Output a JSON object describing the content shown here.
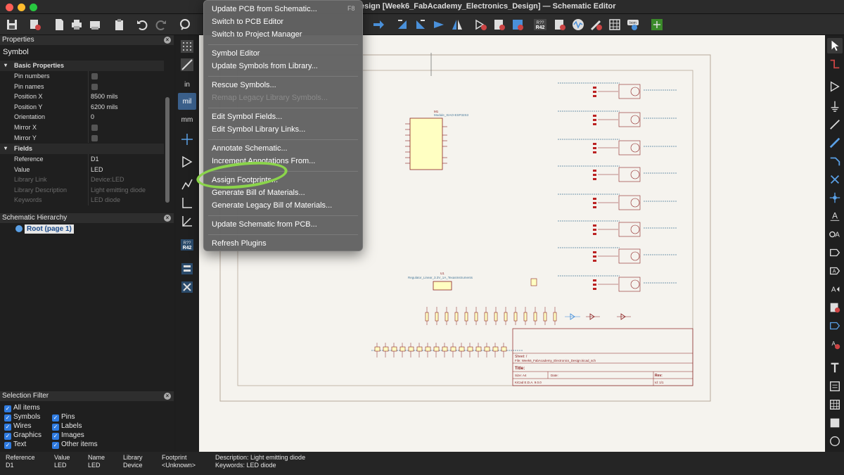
{
  "window": {
    "title": "esign [Week6_FabAcademy_Electronics_Design] — Schematic Editor"
  },
  "menu": {
    "items": [
      {
        "label": "Update PCB from Schematic...",
        "shortcut": "F8",
        "enabled": true
      },
      {
        "label": "Switch to PCB Editor",
        "enabled": true
      },
      {
        "label": "Switch to Project Manager",
        "enabled": true
      },
      {
        "label": "Symbol Editor",
        "enabled": true
      },
      {
        "label": "Update Symbols from Library...",
        "enabled": true
      },
      {
        "label": "Rescue Symbols...",
        "enabled": true
      },
      {
        "label": "Remap Legacy Library Symbols...",
        "enabled": false
      },
      {
        "label": "Edit Symbol Fields...",
        "enabled": true
      },
      {
        "label": "Edit Symbol Library Links...",
        "enabled": true
      },
      {
        "label": "Annotate Schematic...",
        "enabled": true
      },
      {
        "label": "Increment Annotations From...",
        "enabled": true
      },
      {
        "label": "Assign Footprints...",
        "enabled": true
      },
      {
        "label": "Generate Bill of Materials...",
        "enabled": true
      },
      {
        "label": "Generate Legacy Bill of Materials...",
        "enabled": true
      },
      {
        "label": "Update Schematic from PCB...",
        "enabled": true
      },
      {
        "label": "Refresh Plugins",
        "enabled": true
      }
    ]
  },
  "properties": {
    "title": "Properties",
    "subtitle": "Symbol",
    "basic_group": "Basic Properties",
    "rows": [
      {
        "key": "Pin numbers",
        "type": "checkbox"
      },
      {
        "key": "Pin names",
        "type": "checkbox"
      },
      {
        "key": "Position X",
        "value": "8500 mils"
      },
      {
        "key": "Position Y",
        "value": "6200 mils"
      },
      {
        "key": "Orientation",
        "value": "0"
      },
      {
        "key": "Mirror X",
        "type": "checkbox"
      },
      {
        "key": "Mirror Y",
        "type": "checkbox"
      }
    ],
    "fields_group": "Fields",
    "fields": [
      {
        "key": "Reference",
        "value": "D1"
      },
      {
        "key": "Value",
        "value": "LED"
      },
      {
        "key": "Library Link",
        "value": "Device:LED",
        "disabled": true
      },
      {
        "key": "Library Description",
        "value": "Light emitting diode",
        "disabled": true
      },
      {
        "key": "Keywords",
        "value": "LED diode",
        "disabled": true
      }
    ]
  },
  "hierarchy": {
    "title": "Schematic Hierarchy",
    "root": "Root (page 1)"
  },
  "selection_filter": {
    "title": "Selection Filter",
    "items": [
      "All items",
      "Symbols",
      "Pins",
      "Wires",
      "Labels",
      "Graphics",
      "Images",
      "Text",
      "Other items"
    ]
  },
  "units": {
    "in": "in",
    "mil": "mil",
    "mm": "mm"
  },
  "status": {
    "cols": [
      {
        "h": "Reference",
        "v": "D1"
      },
      {
        "h": "Value",
        "v": "LED"
      },
      {
        "h": "Name",
        "v": "LED"
      },
      {
        "h": "Library",
        "v": "Device"
      },
      {
        "h": "Footprint",
        "v": "<Unknown>"
      }
    ],
    "description": "Description: Light emitting diode",
    "keywords": "Keywords: LED diode"
  },
  "schematic": {
    "mcu_ref": "M1",
    "mcu_name": "Module_XIAO-ESP32S3",
    "reg_ref": "U1",
    "reg_name": "Regulator_Linear_3.3V_1A_TexasInstruments",
    "sheet_label": "Sheet: /",
    "file_label": "File: Week6_FabAcademy_Electronics_Design.kicad_sch",
    "title_label": "Title:",
    "size_label": "Size: A4",
    "date_label": "Date:",
    "rev_label": "Rev:",
    "kicad_label": "KiCad E.D.A. 9.0.0",
    "id_label": "Id: 1/1"
  },
  "colors": {
    "accent": "#4a90d9",
    "highlight_circle": "#8bd44b",
    "schematic_bg": "#f5f3ee",
    "wire": "#b44a4a",
    "component": "#8b2020",
    "symbol_fill": "#ffffc2"
  }
}
